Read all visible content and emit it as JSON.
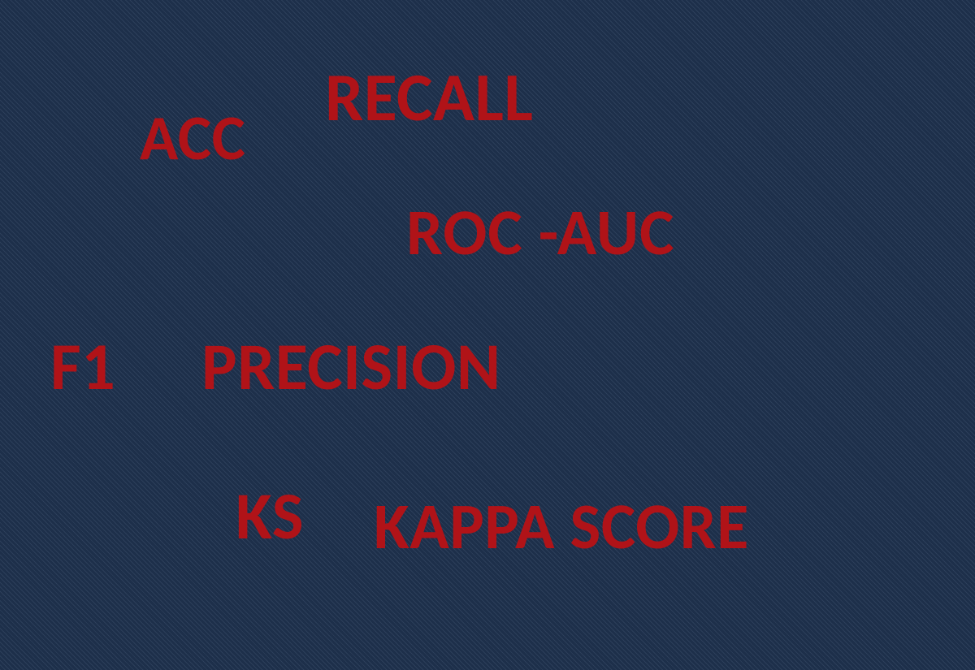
{
  "labels": {
    "recall": "RECALL",
    "acc": "ACC",
    "rocauc": "ROC -AUC",
    "f1": "F1",
    "precision": "PRECISION",
    "ks": "KS",
    "kappa": "KAPPA SCORE"
  },
  "colors": {
    "background": "#1d2f4a",
    "text": "#b01318"
  }
}
